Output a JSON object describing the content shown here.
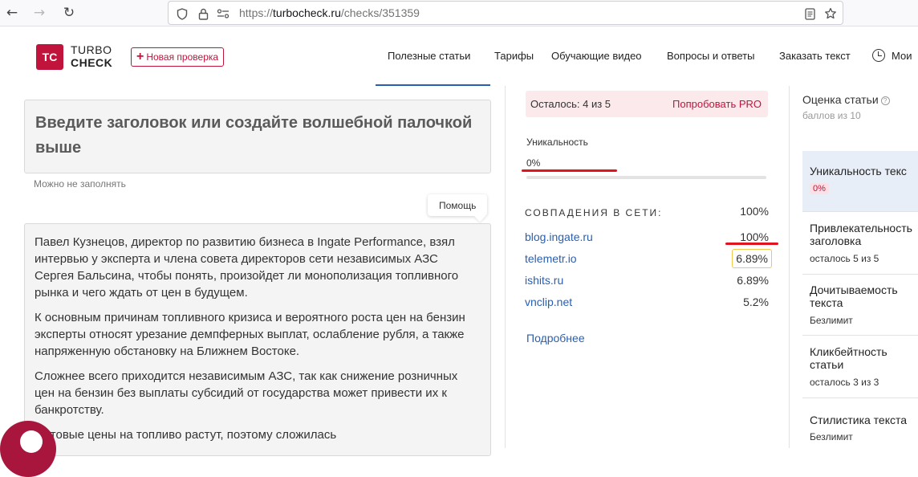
{
  "browser": {
    "url_prefix": "https://",
    "url_host": "turbocheck.ru",
    "url_path": "/checks/351359"
  },
  "header": {
    "logo_mark": "TC",
    "logo_line1": "TURBO",
    "logo_line2": "CHECK",
    "new_check_label": "Новая проверка",
    "nav": [
      "Полезные статьи",
      "Тарифы",
      "Обучающие видео",
      "Вопросы и ответы",
      "Заказать текст",
      "Мои"
    ]
  },
  "editor": {
    "title_placeholder": "Введите заголовок или создайте волшебной палочкой выше",
    "hint": "Можно не заполнять",
    "help_label": "Помощь",
    "paragraphs": [
      "Павел Кузнецов, директор по развитию бизнеса в Ingate Performance, взял интервью у эксперта и члена совета директоров сети независимых АЗС Сергея Бальсина, чтобы понять, произойдет ли монополизация топливного рынка и чего ждать от цен в будущем.",
      "К основным причинам топливного кризиса и вероятного роста цен на бензин эксперты относят урезание демпферных выплат, ослабление рубля, а также напряженную обстановку на Ближнем Востоке.",
      "Сложнее всего приходится независимым АЗС, так как снижение розничных цен на бензин без выплаты субсидий от государства может привести их к банкротству.",
      "Оптовые цены на топливо растут, поэтому сложилась"
    ]
  },
  "results": {
    "limit_text": "Осталось: 4 из 5",
    "pro_label": "Попробовать PRO",
    "uniqueness_label": "Уникальность",
    "uniqueness_value": "0%",
    "uniqueness_fraction": 0,
    "matches_title": "СОВПАДЕНИЯ В СЕТИ:",
    "matches_total": "100%",
    "matches": [
      {
        "host": "blog.ingate.ru",
        "pct": "100%"
      },
      {
        "host": "telemetr.io",
        "pct": "6.89%"
      },
      {
        "host": "ishits.ru",
        "pct": "6.89%"
      },
      {
        "host": "vnclip.net",
        "pct": "5.2%"
      }
    ],
    "more_label": "Подробнее"
  },
  "score": {
    "title": "Оценка статьи",
    "subtitle": "баллов из 10",
    "metrics": [
      {
        "title": "Уникальность текс",
        "badge": "0%"
      },
      {
        "title": "Привлекательность",
        "title2": "заголовка",
        "sub": "осталось 5 из 5"
      },
      {
        "title": "Дочитываемость",
        "title2": "текста",
        "sub": "Безлимит"
      },
      {
        "title": "Кликбейтность",
        "title2": "статьи",
        "sub": "осталось 3 из 3"
      },
      {
        "title": "Стилистика текста",
        "sub": "Безлимит"
      }
    ]
  },
  "colors": {
    "brand": "#c0143c",
    "link": "#2a5fb0",
    "annotation_red": "#e0141e",
    "highlight_box": "#f2c94c"
  }
}
